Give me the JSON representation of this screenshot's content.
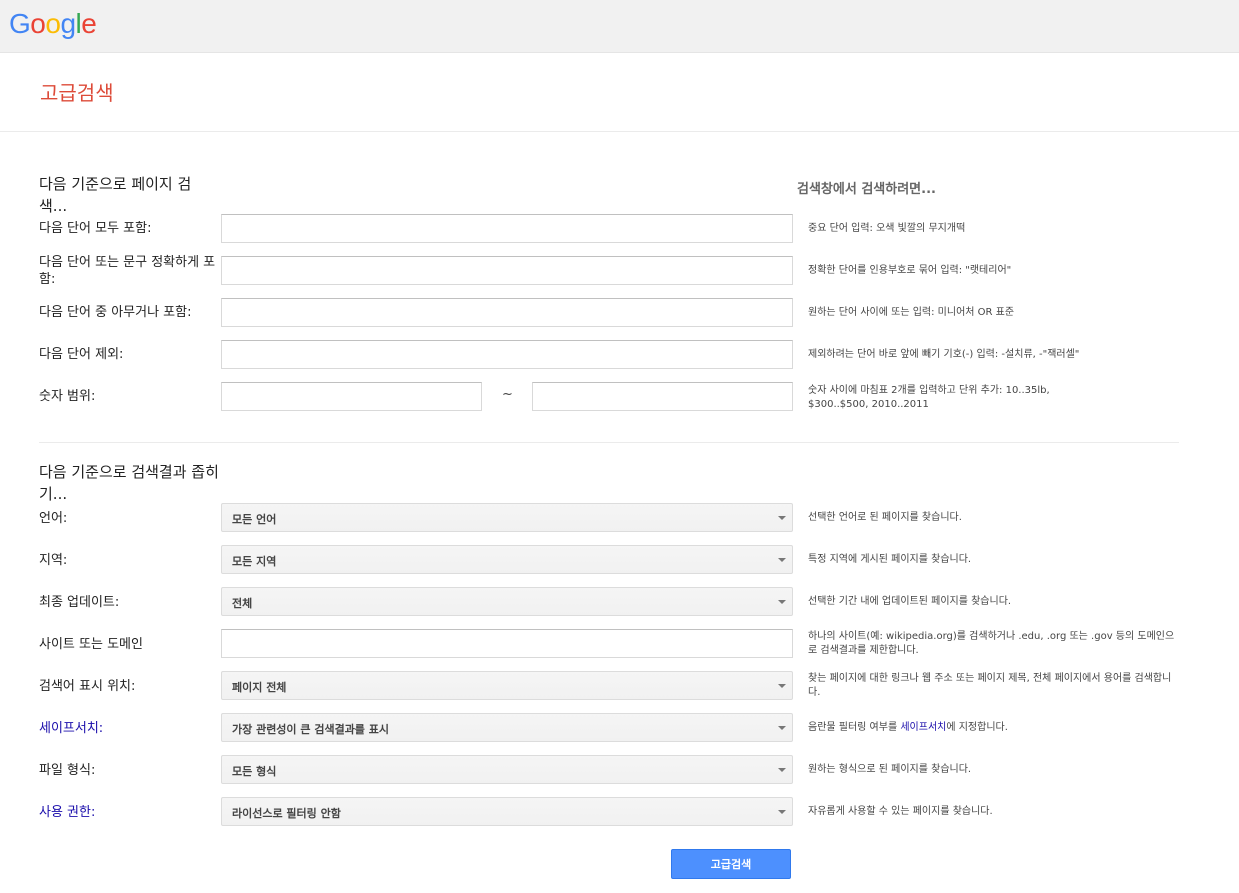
{
  "header": {
    "logo_text": "Google",
    "page_title": "고급검색"
  },
  "find_section": {
    "heading": "다음 기준으로 페이지 검색...",
    "hint_heading": "검색창에서 검색하려면...",
    "rows": [
      {
        "label": "다음 단어 모두 포함:",
        "value": "",
        "hint": "중요 단어 입력: 오색 빛깔의 무지개떡"
      },
      {
        "label": "다음 단어 또는 문구 정확하게 포함:",
        "value": "",
        "hint": "정확한 단어를 인용부호로 묶어 입력: \"랫테리어\""
      },
      {
        "label": "다음 단어 중 아무거나 포함:",
        "value": "",
        "hint": "원하는 단어 사이에 또는 입력: 미니어처 OR 표준"
      },
      {
        "label": "다음 단어 제외:",
        "value": "",
        "hint": "제외하려는 단어 바로 앞에 빼기 기호(-) 입력: -설치류, -\"잭러셀\""
      },
      {
        "label": "숫자 범위:",
        "from": "",
        "separator": "~",
        "to": "",
        "hint": "숫자 사이에 마침표 2개를 입력하고 단위 추가: 10..35lb, $300..$500, 2010..2011"
      }
    ]
  },
  "narrow_section": {
    "heading": "다음 기준으로 검색결과 좁히기...",
    "rows": [
      {
        "label": "언어:",
        "selected": "모든 언어",
        "hint": "선택한 언어로 된 페이지를 찾습니다."
      },
      {
        "label": "지역:",
        "selected": "모든 지역",
        "hint": "특정 지역에 게시된 페이지를 찾습니다."
      },
      {
        "label": "최종 업데이트:",
        "selected": "전체",
        "hint": "선택한 기간 내에 업데이트된 페이지를 찾습니다."
      },
      {
        "label": "사이트 또는 도메인",
        "value": "",
        "hint": "하나의 사이트(예: wikipedia.org)를 검색하거나 .edu, .org 또는 .gov 등의 도메인으로 검색결과를 제한합니다."
      },
      {
        "label": "검색어 표시 위치:",
        "selected": "페이지 전체",
        "hint": "찾는 페이지에 대한 링크나 웹 주소 또는 페이지 제목, 전체 페이지에서 용어를 검색합니다."
      },
      {
        "label": "세이프서치:",
        "selected": "가장 관련성이 큰 검색결과를 표시",
        "hint_before": "음란물 필터링 여부를 ",
        "hint_link": "세이프서치",
        "hint_after": "에 지정합니다."
      },
      {
        "label": "파일 형식:",
        "selected": "모든 형식",
        "hint": "원하는 형식으로 된 페이지를 찾습니다."
      },
      {
        "label": "사용 권한:",
        "selected": "라이선스로 필터링 안함",
        "hint": "자유롭게 사용할 수 있는 페이지를 찾습니다."
      }
    ]
  },
  "submit_label": "고급검색",
  "colors": {
    "title": "#dd4b39",
    "link": "#1a0dab",
    "button": "#4d90fe"
  }
}
